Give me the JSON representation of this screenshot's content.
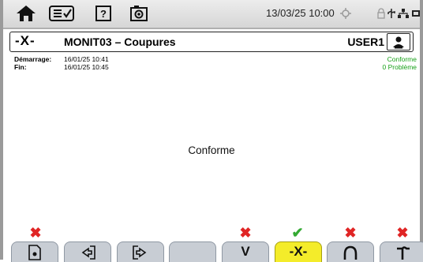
{
  "status_bar": {
    "datetime": "13/03/25 10:00",
    "icons": [
      "home-icon",
      "checklist-icon",
      "help-icon",
      "camera-icon",
      "gps-icon",
      "lock-icon",
      "usb-icon",
      "network-icon",
      "battery-icon"
    ]
  },
  "title_bar": {
    "logo": "-X-",
    "title": "MONIT03 – Coupures",
    "user": "USER1"
  },
  "info": {
    "start_label": "Démarrage:",
    "start_value": "16/01/25 10:41",
    "end_label": "Fin:",
    "end_value": "16/01/25 10:45",
    "status": "Conforme",
    "problems": "0 Problème"
  },
  "main_message": "Conforme",
  "tabs": [
    {
      "name": "report",
      "label": "",
      "mark": "red",
      "mark_glyph": "✖"
    },
    {
      "name": "import",
      "label": "",
      "mark": "",
      "mark_glyph": ""
    },
    {
      "name": "export",
      "label": "",
      "mark": "",
      "mark_glyph": ""
    },
    {
      "name": "empty",
      "label": "",
      "mark": "",
      "mark_glyph": ""
    },
    {
      "name": "dips",
      "label": "V",
      "mark": "red",
      "mark_glyph": "✖"
    },
    {
      "name": "interruptions",
      "label": "-X-",
      "mark": "green",
      "mark_glyph": "✔"
    },
    {
      "name": "swells",
      "label": "",
      "mark": "red",
      "mark_glyph": "✖"
    },
    {
      "name": "transients",
      "label": "",
      "mark": "red",
      "mark_glyph": "✖"
    }
  ],
  "colors": {
    "accent_yellow": "#f4ec2a",
    "ok_green": "#19a11a",
    "fail_red": "#e02525",
    "tab_gray": "#c8cdd4"
  }
}
